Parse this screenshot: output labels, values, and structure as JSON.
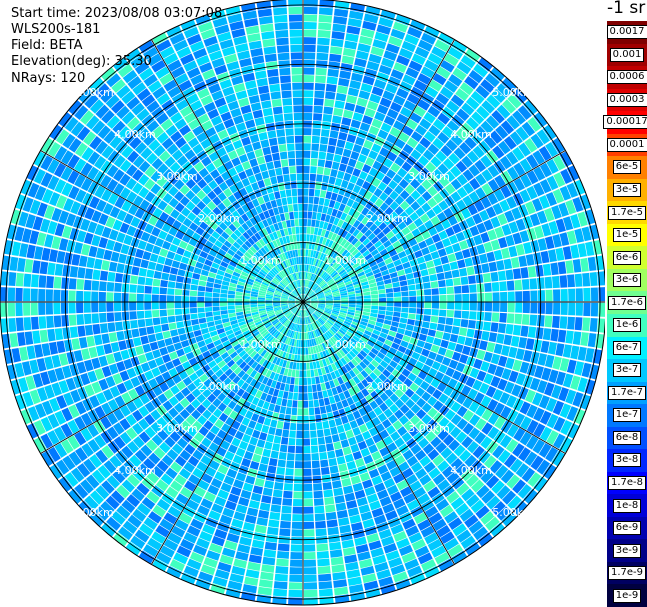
{
  "header": {
    "start_time": "Start time: 2023/08/08 03:07:08",
    "instrument": "WLS200s-181",
    "field": "Field: BETA",
    "elevation": "Elevation(deg): 35.30",
    "nrays": "NRays: 120"
  },
  "colorbar": {
    "title": "-1 sr",
    "ticks": [
      "0.0017",
      "0.001",
      "0.0006",
      "0.0003",
      "0.00017",
      "0.0001",
      "6e-5",
      "3e-5",
      "1.7e-5",
      "1e-5",
      "6e-6",
      "3e-6",
      "1.7e-6",
      "1e-6",
      "6e-7",
      "3e-7",
      "1.7e-7",
      "1e-7",
      "6e-8",
      "3e-8",
      "1.7e-8",
      "1e-8",
      "6e-9",
      "3e-9",
      "1.7e-9",
      "1e-9"
    ],
    "colors": [
      "#7f0000",
      "#a00000",
      "#c00000",
      "#e00000",
      "#ff0000",
      "#ff4000",
      "#ff8000",
      "#ffb000",
      "#ffd800",
      "#ffff00",
      "#d0ff30",
      "#a0ff60",
      "#70ff90",
      "#40ffc0",
      "#00f0ff",
      "#00c8ff",
      "#00a0ff",
      "#0078ff",
      "#0050ff",
      "#0028ff",
      "#0000ff",
      "#0000d8",
      "#0000b0",
      "#000088",
      "#000060",
      "#000040"
    ]
  },
  "chart_data": {
    "type": "heatmap",
    "projection": "polar (PPI)",
    "field": "BETA",
    "rays": 120,
    "range_rings_km": [
      "1.00km",
      "2.00km",
      "3.00km",
      "4.00km",
      "5.00km"
    ],
    "range_ring_values_km": [
      1,
      2,
      3,
      4,
      5
    ],
    "max_range_km": 5.1,
    "spokes_deg": [
      0,
      30,
      60,
      90,
      120,
      150,
      180,
      210,
      240,
      270,
      300,
      330
    ],
    "dominant_colors": [
      "#00c8ff",
      "#00a0ff",
      "#0078ff",
      "#40ffc0"
    ]
  }
}
